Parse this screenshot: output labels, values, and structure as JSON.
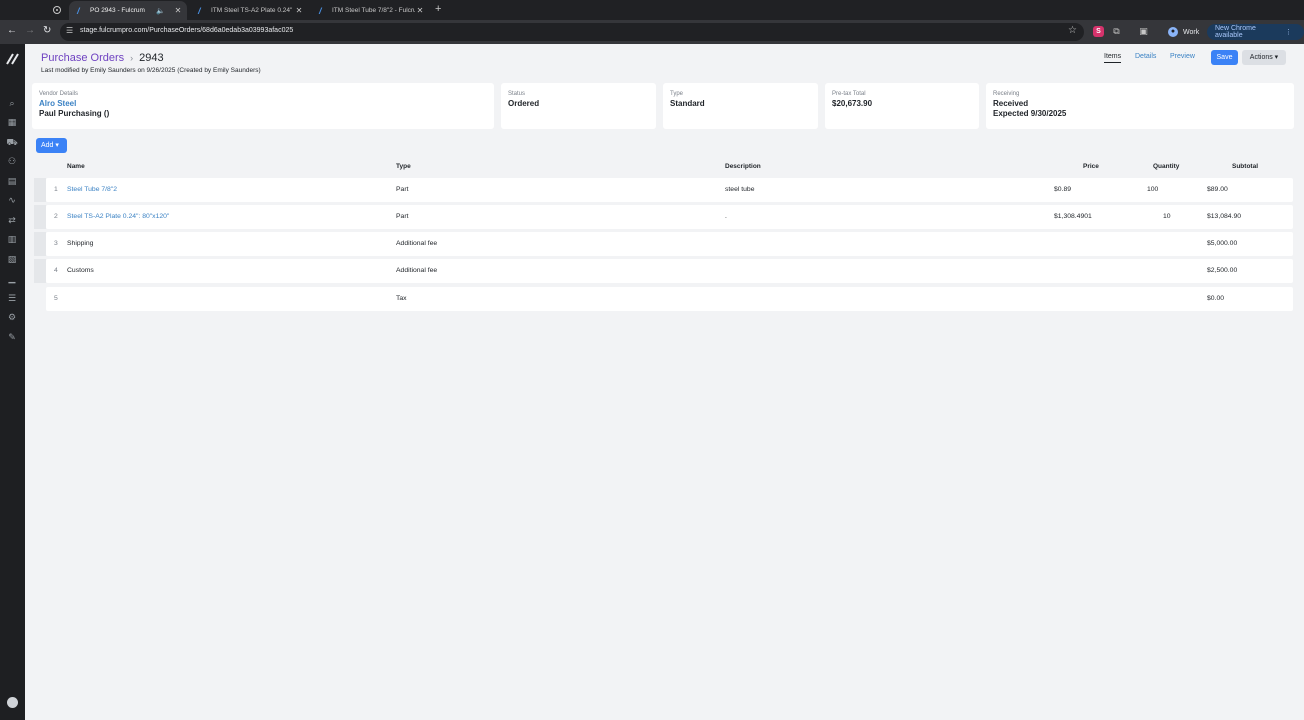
{
  "browser": {
    "tabs": [
      {
        "title": "PO 2943 - Fulcrum",
        "active": true
      },
      {
        "title": "ITM Steel TS-A2 Plate 0.24\"",
        "active": false
      },
      {
        "title": "ITM Steel Tube 7/8\"2 - Fulcru",
        "active": false
      }
    ],
    "url": "stage.fulcrumpro.com/PurchaseOrders/68d6a0edab3a03993afac025",
    "profile_label": "Work",
    "update_label": "New Chrome available",
    "extension_letter": "S"
  },
  "breadcrumb": {
    "parent": "Purchase Orders",
    "separator": "›",
    "current": "2943"
  },
  "modified_text": "Last modified by Emily Saunders on 9/26/2025 (Created by Emily Saunders)",
  "top_nav": {
    "items": "Items",
    "details": "Details",
    "preview": "Preview",
    "save": "Save",
    "actions": "Actions ▾"
  },
  "cards": {
    "vendor": {
      "label": "Vendor Details",
      "name": "Alro Steel",
      "contact": "Paul Purchasing ()"
    },
    "status": {
      "label": "Status",
      "value": "Ordered"
    },
    "type": {
      "label": "Type",
      "value": "Standard"
    },
    "pretax": {
      "label": "Pre-tax Total",
      "value": "$20,673.90"
    },
    "receiving": {
      "label": "Receiving",
      "value": "Received",
      "expected": "Expected 9/30/2025"
    }
  },
  "add_button": "Add ▾",
  "table": {
    "headers": {
      "name": "Name",
      "type": "Type",
      "description": "Description",
      "price": "Price",
      "quantity": "Quantity",
      "subtotal": "Subtotal"
    },
    "rows": [
      {
        "idx": "1",
        "name": "Steel Tube 7/8\"2",
        "type": "Part",
        "description": "steel tube",
        "price": "$0.89",
        "quantity": "100",
        "subtotal": "$89.00"
      },
      {
        "idx": "2",
        "name": "Steel TS-A2 Plate 0.24\": 80\"x120\"",
        "type": "Part",
        "description": ".",
        "price": "$1,308.4901",
        "quantity": "10",
        "subtotal": "$13,084.90"
      },
      {
        "idx": "3",
        "name": "Shipping",
        "type": "Additional fee",
        "description": "",
        "price": "",
        "quantity": "",
        "subtotal": "$5,000.00"
      },
      {
        "idx": "4",
        "name": "Customs",
        "type": "Additional fee",
        "description": "",
        "price": "",
        "quantity": "",
        "subtotal": "$2,500.00"
      },
      {
        "idx": "5",
        "name": "",
        "type": "Tax",
        "description": "",
        "price": "",
        "quantity": "",
        "subtotal": "$0.00"
      }
    ]
  },
  "icons": {
    "sidebar": [
      "search-icon",
      "grid-icon",
      "cart-icon",
      "users-icon",
      "calendar-icon",
      "activity-icon",
      "transfer-icon",
      "calculator-icon",
      "boxes-icon",
      "chart-icon",
      "list-icon",
      "settings-icon",
      "wrench-icon"
    ]
  },
  "colors": {
    "accent": "#3b82f6",
    "link": "#3b82c4",
    "breadcrumb": "#6f42c1"
  }
}
